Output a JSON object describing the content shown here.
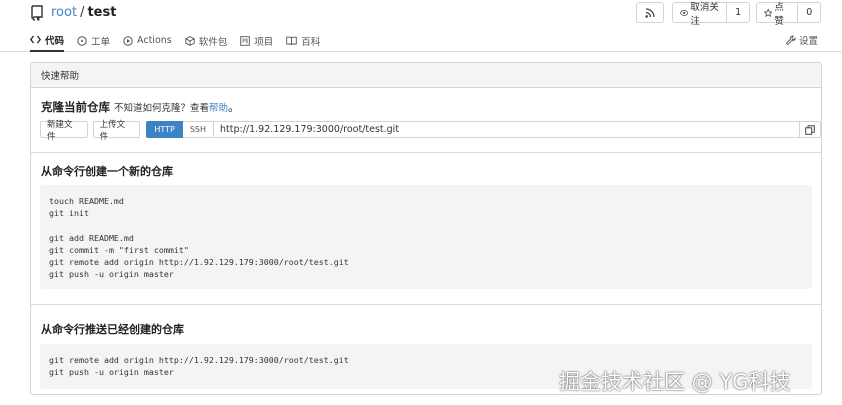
{
  "repo": {
    "owner": "root",
    "separator": "/",
    "name": "test"
  },
  "actions": {
    "watch_label": "取消关注",
    "watch_count": "1",
    "star_label": "点赞",
    "star_count": "0"
  },
  "tabs": [
    {
      "label": "代码",
      "icon": "code-icon",
      "active": true
    },
    {
      "label": "工单",
      "icon": "issue-icon"
    },
    {
      "label": "Actions",
      "icon": "play-circle-icon"
    },
    {
      "label": "软件包",
      "icon": "package-icon"
    },
    {
      "label": "项目",
      "icon": "project-icon"
    },
    {
      "label": "百科",
      "icon": "book-icon"
    }
  ],
  "settings_label": "设置",
  "quick_help": {
    "title": "快速帮助",
    "clone_title": "克隆当前仓库",
    "clone_hint": "不知道如何克隆？查看",
    "clone_help_link": "帮助",
    "clone_period": "。",
    "new_file_label": "新建文件",
    "upload_file_label": "上传文件",
    "http_label": "HTTP",
    "ssh_label": "SSH",
    "clone_url": "http://1.92.129.179:3000/root/test.git"
  },
  "new_repo_section": {
    "title": "从命令行创建一个新的仓库",
    "code": "touch README.md\ngit init\n\ngit add README.md\ngit commit -m \"first commit\"\ngit remote add origin http://1.92.129.179:3000/root/test.git\ngit push -u origin master"
  },
  "push_existing_section": {
    "title": "从命令行推送已经创建的仓库",
    "code": "git remote add origin http://1.92.129.179:3000/root/test.git\ngit push -u origin master"
  },
  "watermark": "掘金技术社区 @ YG科技"
}
